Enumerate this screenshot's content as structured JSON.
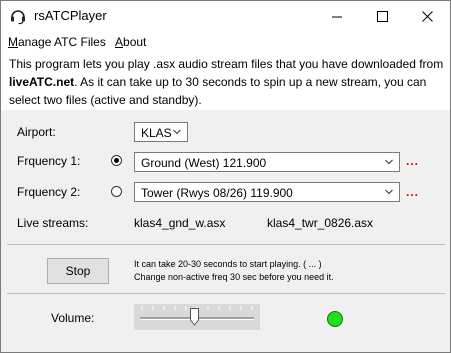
{
  "app": {
    "title": "rsATCPlayer",
    "icon": "headset-icon"
  },
  "menu": {
    "items": [
      {
        "prefix": "M",
        "rest": "anage ATC Files"
      },
      {
        "prefix": "A",
        "rest": "bout"
      }
    ]
  },
  "intro": {
    "part1": "This program lets you play .asx audio stream files that you have downloaded from ",
    "link": "liveATC.net",
    "part2": ". As it can take up to 30 seconds to spin up a new stream, you can select two files (active and standby)."
  },
  "form": {
    "airport_label": "Airport:",
    "airport_value": "KLAS",
    "freq1_label": "Frquency 1:",
    "freq1_value": "Ground (West) 121.900",
    "freq1_selected": true,
    "freq2_label": "Frquency 2:",
    "freq2_value": "Tower (Rwys 08/26) 119.900",
    "freq2_selected": false,
    "browse": "...",
    "streams_label": "Live streams:",
    "stream1": "klas4_gnd_w.asx",
    "stream2": "klas4_twr_0826.asx"
  },
  "controls": {
    "stop_label": "Stop",
    "note_line1": "It can take 20-30 seconds to start playing. ( ... )",
    "note_line2": "Change non-active freq 30 sec before you need it.",
    "volume_label": "Volume:",
    "volume_level": 0.48,
    "status_color": "#22dd22"
  }
}
